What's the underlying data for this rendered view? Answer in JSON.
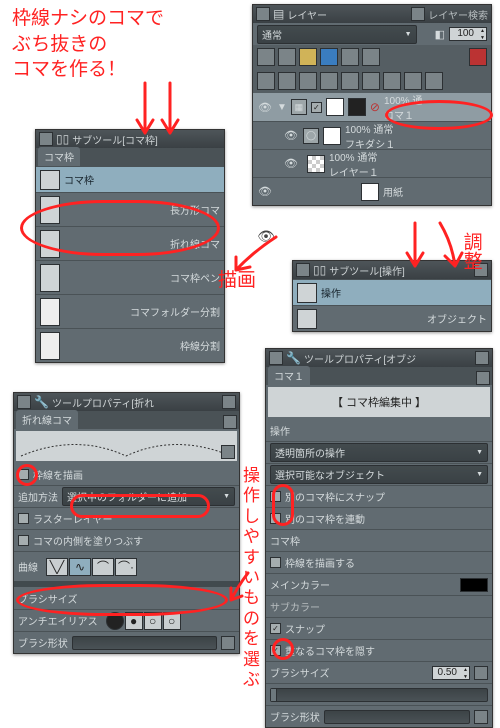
{
  "annotations": {
    "top_note": "枠線ナシのコマで\nぶち抜きの\nコマを作る！",
    "draw_label": "描画",
    "adjust_label": "調整",
    "choose_label": "操\n作\nし\nや\nす\nい\nも\nの\nを\n選\nぶ"
  },
  "layer_panel": {
    "title": "レイヤー",
    "search_tab": "レイヤー検索",
    "blend_mode": "通常",
    "opacity": "100",
    "layers": [
      {
        "name": "コマ１",
        "percent": "100% 通",
        "selected": true
      },
      {
        "name": "フキダシ１",
        "percent": "100% 通常"
      },
      {
        "name": "レイヤー１",
        "percent": "100% 通常"
      },
      {
        "name": "用紙",
        "percent": ""
      }
    ]
  },
  "subtool_koma": {
    "title": "サブツール[コマ枠]",
    "tab": "コマ枠",
    "items": [
      "コマ枠",
      "長方形コマ",
      "折れ線コマ",
      "コマ枠ペン",
      "コマフォルダー分割",
      "枠線分割"
    ]
  },
  "subtool_op": {
    "title": "サブツール[操作]",
    "items": [
      "操作",
      "オブジェクト"
    ]
  },
  "tool_prop_left": {
    "title": "ツールプロパティ[折れ",
    "tab": "折れ線コマ",
    "draw_frame": "枠線を描画",
    "add_method_label": "追加方法",
    "add_method_value": "選択中のフォルダーに追加",
    "raster": "ラスターレイヤー",
    "fill_inside": "コマの内側を塗りつぶす",
    "curve_label": "曲線",
    "brush_size": "ブラシサイズ",
    "antialias": "アンチエイリアス",
    "brush_shape": "ブラシ形状"
  },
  "tool_prop_right": {
    "title": "ツールプロパティ[オブジ",
    "tab": "コマ１",
    "editing": "【 コマ枠編集中 】",
    "op_label": "操作",
    "op_dd1": "透明箇所の操作",
    "op_dd2": "選択可能なオブジェクト",
    "snap_other": "別のコマ枠にスナップ",
    "link_other": "別のコマ枠を連動",
    "koma_label": "コマ枠",
    "draw_frame": "枠線を描画する",
    "main_color": "メインカラー",
    "sub_color": "サブカラー",
    "snap": "スナップ",
    "hide_overlap": "重なるコマ枠を隠す",
    "brush_size": "ブラシサイズ",
    "brush_size_val": "0.50",
    "brush_shape": "ブラシ形状"
  }
}
